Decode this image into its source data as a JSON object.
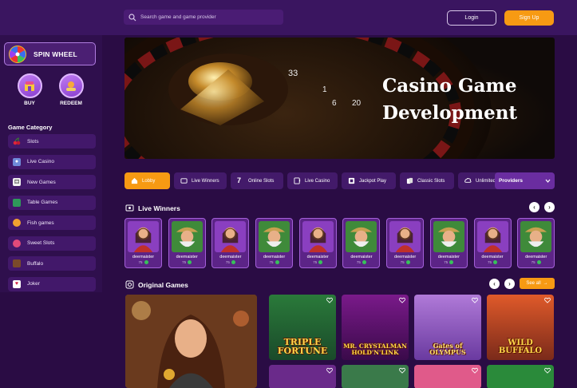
{
  "header": {
    "search_placeholder": "Search game and game provider",
    "login_label": "Login",
    "signup_label": "Sign Up"
  },
  "sidebar": {
    "spin_wheel_label": "SPIN WHEEL",
    "buy_label": "BUY",
    "redeem_label": "REDEEM",
    "category_title": "Game Category",
    "categories": [
      {
        "label": "Slots",
        "icon": "cherry-icon"
      },
      {
        "label": "Live Casino",
        "icon": "dealer-icon"
      },
      {
        "label": "New Games",
        "icon": "dice-icon"
      },
      {
        "label": "Table Games",
        "icon": "table-icon"
      },
      {
        "label": "Fish games",
        "icon": "fish-icon"
      },
      {
        "label": "Sweet Slots",
        "icon": "candy-icon"
      },
      {
        "label": "Buffalo",
        "icon": "buffalo-icon"
      },
      {
        "label": "Joker",
        "icon": "joker-icon"
      }
    ]
  },
  "banner": {
    "title_line1": "Casino Game",
    "title_line2": "Development"
  },
  "tabs": [
    {
      "label": "Lobby",
      "icon": "home-icon",
      "active": true
    },
    {
      "label": "Live Winners",
      "icon": "trophy-icon",
      "active": false
    },
    {
      "label": "Online Slots",
      "icon": "seven-icon",
      "active": false
    },
    {
      "label": "Live Casino",
      "icon": "slot-machine-icon",
      "active": false
    },
    {
      "label": "Jackpot Play",
      "icon": "jackpot-icon",
      "active": false
    },
    {
      "label": "Classic Slots",
      "icon": "cards-icon",
      "active": false
    },
    {
      "label": "Unlimited",
      "icon": "cloud-icon",
      "active": false
    }
  ],
  "providers_label": "Providers",
  "live_winners": {
    "title": "Live Winners",
    "items": [
      {
        "name": "deemaister",
        "amount": "75"
      },
      {
        "name": "deemaister",
        "amount": "75"
      },
      {
        "name": "deemaister",
        "amount": "75"
      },
      {
        "name": "deemaister",
        "amount": "75"
      },
      {
        "name": "deemaister",
        "amount": "75"
      },
      {
        "name": "deemaister",
        "amount": "75"
      },
      {
        "name": "deemaister",
        "amount": "75"
      },
      {
        "name": "deemaister",
        "amount": "75"
      },
      {
        "name": "deemaister",
        "amount": "75"
      },
      {
        "name": "deemaister",
        "amount": "75"
      }
    ]
  },
  "original_games": {
    "title": "Original Games",
    "see_all_label": "See all",
    "games": [
      {
        "name": "TRIPLE FORTUNE"
      },
      {
        "name": "MR. CRYSTALMAN HOLD'N'LINK"
      },
      {
        "name": "Gates of OLYMPUS"
      },
      {
        "name": "WILD BUFFALO"
      }
    ]
  },
  "colors": {
    "accent": "#f79a13",
    "background": "#2a0c44",
    "panel": "#3a1560"
  }
}
